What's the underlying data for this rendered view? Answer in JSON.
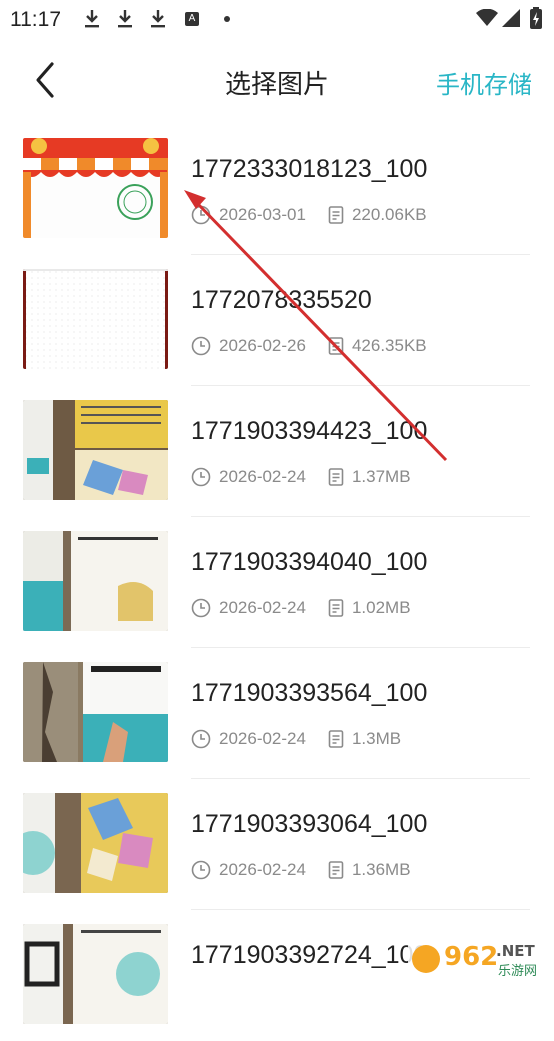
{
  "status_bar": {
    "time": "11:17"
  },
  "header": {
    "title": "选择图片",
    "storage_label": "手机存储"
  },
  "files": [
    {
      "name": "1772333018123_100",
      "date": "2026-03-01",
      "size": "220.06KB"
    },
    {
      "name": "1772078335520",
      "date": "2026-02-26",
      "size": "426.35KB"
    },
    {
      "name": "1771903394423_100",
      "date": "2026-02-24",
      "size": "1.37MB"
    },
    {
      "name": "1771903394040_100",
      "date": "2026-02-24",
      "size": "1.02MB"
    },
    {
      "name": "1771903393564_100",
      "date": "2026-02-24",
      "size": "1.3MB"
    },
    {
      "name": "1771903393064_100",
      "date": "2026-02-24",
      "size": "1.36MB"
    },
    {
      "name": "1771903392724_100",
      "date": "",
      "size": ""
    }
  ],
  "watermark": {
    "number": "962",
    "suffix": ".NET",
    "sub": "乐游网"
  },
  "colors": {
    "accent": "#29b6c6",
    "arrow": "#d32f2f"
  }
}
